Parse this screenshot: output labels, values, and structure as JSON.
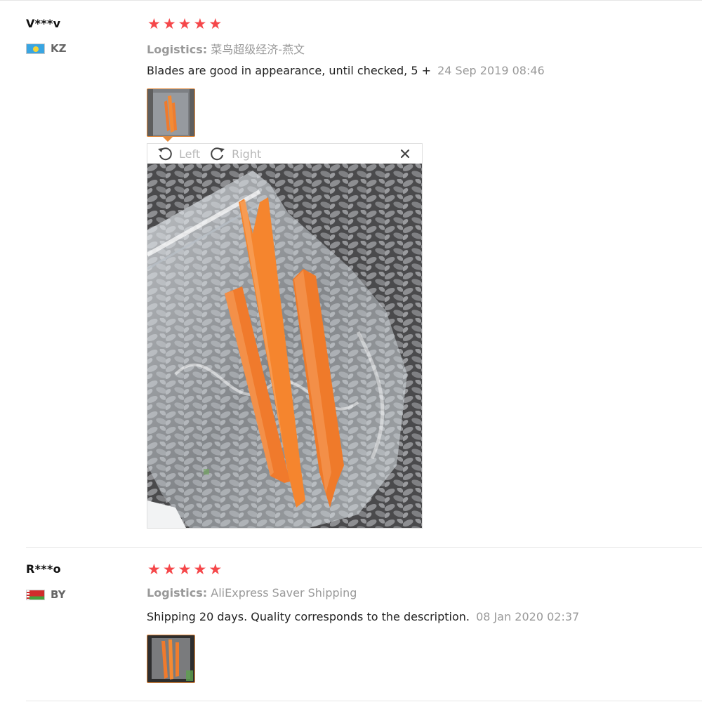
{
  "reviews": [
    {
      "user": "V***v",
      "country_code": "KZ",
      "rating": 5,
      "logistics_label": "Logistics:",
      "logistics_value": "菜鸟超级经济-燕文",
      "feedback": "Blades are good in appearance, until checked, 5 +",
      "date": "24 Sep 2019 08:46"
    },
    {
      "user": "R***o",
      "country_code": "BY",
      "rating": 5,
      "logistics_label": "Logistics:",
      "logistics_value": "AliExpress Saver Shipping",
      "feedback": "Shipping 20 days. Quality corresponds to the description.",
      "date": "08 Jan 2020 02:37"
    }
  ],
  "viewer": {
    "rotate_left": "Left",
    "rotate_right": "Right"
  },
  "colors": {
    "star": "#f5474a",
    "thumb_border": "#e58a3a",
    "muted_text": "#999999"
  }
}
